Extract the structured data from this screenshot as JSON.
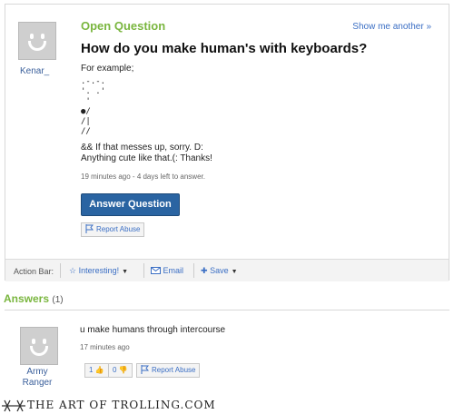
{
  "question": {
    "status": "Open Question",
    "show_another": "Show me another »",
    "asker": "Kenar_",
    "title": "How do you make human's with keyboards?",
    "intro": "For example;",
    "ascii_art": ".-.-.\n'. .'\n '\n●/\n/|\n//",
    "line1": "&& If that messes up, sorry. D:",
    "line2": "Anything cute like that.(: Thanks!",
    "meta": "19 minutes ago - 4 days left to answer.",
    "answer_button": "Answer Question",
    "report_abuse": "Report Abuse"
  },
  "action_bar": {
    "label": "Action Bar:",
    "interesting": "Interesting!",
    "email": "Email",
    "save": "Save"
  },
  "answers": {
    "heading": "Answers",
    "count": "(1)",
    "items": [
      {
        "name_line1": "Army",
        "name_line2": "Ranger",
        "text": "u make humans through intercourse",
        "meta": "17 minutes ago",
        "thumbs_up": "1",
        "thumbs_down": "0",
        "report_abuse": "Report Abuse"
      }
    ]
  },
  "footer": {
    "text": "THE ART OF TROLLING.COM"
  },
  "colors": {
    "accent_green": "#7ab63f",
    "link_blue": "#3a6ec4",
    "button_blue": "#2a64a2"
  }
}
